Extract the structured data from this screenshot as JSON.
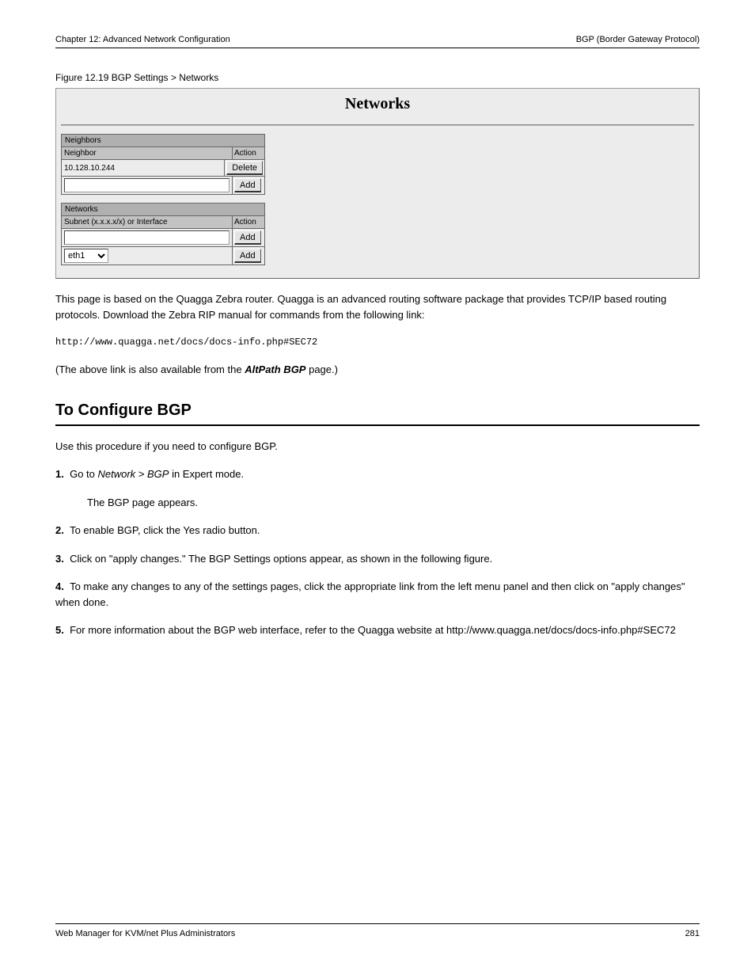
{
  "header": {
    "left": "Chapter 12: Advanced Network Configuration",
    "right": "BGP (Border Gateway Protocol)"
  },
  "figure": {
    "label": "Figure 12.19 BGP Settings > Networks"
  },
  "screenshot": {
    "title": "Networks",
    "neighbors": {
      "caption": "Neighbors",
      "col_left": "Neighbor",
      "col_right": "Action",
      "existing_value": "10.128.10.244",
      "delete_label": "Delete",
      "add_label": "Add"
    },
    "networks": {
      "caption": "Networks",
      "col_left": "Subnet (x.x.x.x/x) or Interface",
      "col_right": "Action",
      "add_label": "Add",
      "select_value": "eth1"
    }
  },
  "paragraphs": {
    "p1": "This page is based on the Quagga Zebra router. Quagga is an advanced routing software package that provides TCP/IP based routing protocols. Download the Zebra RIP manual for commands from the following link:",
    "link": "http://www.quagga.net/docs/docs-info.php#SEC72",
    "subnote_prefix": "(The above link is also available from the ",
    "subnote_bold": "AltPath BGP",
    "subnote_suffix": " page.)"
  },
  "section": {
    "heading": "To Configure BGP",
    "intro": "Use this procedure if you need to configure BGP.",
    "step1_num": "1.",
    "step1_text_a": "Go to ",
    "step1_text_b": "Network > BGP",
    "step1_text_c": " in Expert mode.",
    "step1_cont": "The BGP page appears.",
    "step2_num": "2.",
    "step2_text": "To enable BGP, click the Yes radio button.",
    "step3_num": "3.",
    "step3_text": "Click on \"apply changes.\" The BGP Settings options appear, as shown in the following figure.",
    "step4_num": "4.",
    "step4_text": "To make any changes to any of the settings pages, click the appropriate link from the left menu panel and then click on \"apply changes\" when done.",
    "step5_num": "5.",
    "step5_text": "For more information about the BGP web interface, refer to the Quagga website at http://www.quagga.net/docs/docs-info.php#SEC72"
  },
  "footer": {
    "left": "Web Manager for KVM/net Plus Administrators",
    "right": "281"
  }
}
